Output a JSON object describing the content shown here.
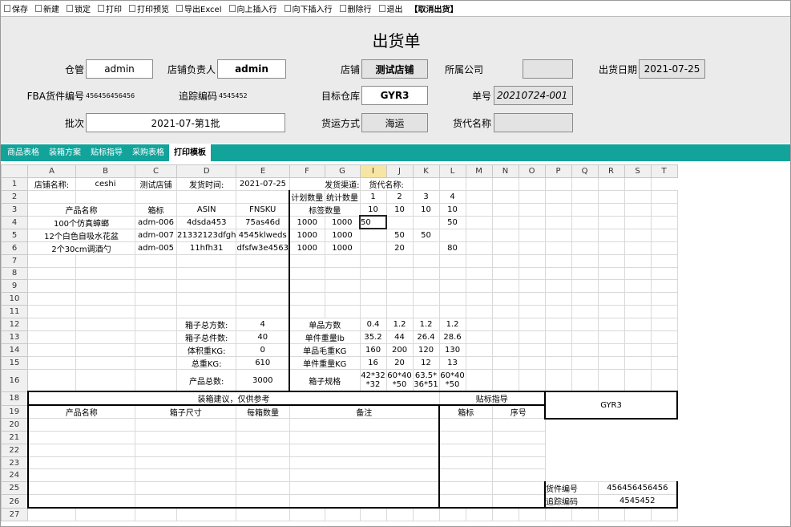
{
  "toolbar": [
    {
      "label": "保存",
      "icon": "save-icon"
    },
    {
      "label": "新建",
      "icon": "new-icon"
    },
    {
      "label": "锁定",
      "icon": "lock-icon"
    },
    {
      "label": "打印",
      "icon": "print-icon"
    },
    {
      "label": "打印预览",
      "icon": "print-preview-icon"
    },
    {
      "label": "导出Excel",
      "icon": "excel-icon"
    },
    {
      "label": "向上插入行",
      "icon": "insert-row-above-icon"
    },
    {
      "label": "向下插入行",
      "icon": "insert-row-below-icon"
    },
    {
      "label": "删除行",
      "icon": "delete-row-icon"
    },
    {
      "label": "退出",
      "icon": "exit-icon"
    },
    {
      "label": "【取消出货】",
      "icon": ""
    }
  ],
  "form": {
    "title": "出货单",
    "warehouse_label": "仓管",
    "warehouse_value": "admin",
    "store_manager_label": "店铺负责人",
    "store_manager_value": "admin",
    "store_label": "店铺",
    "store_value": "测试店铺",
    "company_label": "所属公司",
    "company_value": "",
    "ship_date_label": "出货日期",
    "ship_date_value": "2021-07-25",
    "fba_label": "FBA货件编号",
    "fba_value": "456456456456",
    "tracking_label": "追踪编码",
    "tracking_value": "4545452",
    "target_wh_label": "目标仓库",
    "target_wh_value": "GYR3",
    "order_no_label": "单号",
    "order_no_value": "20210724-001",
    "batch_label": "批次",
    "batch_value": "2021-07-第1批",
    "ship_method_label": "货运方式",
    "ship_method_value": "海运",
    "forwarder_label": "货代名称",
    "forwarder_value": ""
  },
  "tabs": [
    "商品表格",
    "装箱方案",
    "贴标指导",
    "采购表格",
    "打印模板"
  ],
  "columns": [
    "A",
    "B",
    "C",
    "D",
    "E",
    "F",
    "G",
    "I",
    "J",
    "K",
    "L",
    "M",
    "N",
    "O",
    "P",
    "Q",
    "R",
    "S",
    "T"
  ],
  "sheet": {
    "r1": {
      "a": "店铺名称:",
      "b": "ceshi",
      "c": "测试店铺",
      "d": "发货时间:",
      "e": "2021-07-25",
      "f": "发货渠道:",
      "h": "货代名称:"
    },
    "r2": {
      "f": "计划数量",
      "g": "统计数量",
      "i": "1",
      "j": "2",
      "k": "3",
      "l": "4"
    },
    "r3": {
      "ab": "产品名称",
      "c": "箱标",
      "d": "ASIN",
      "e": "FNSKU",
      "fg": "标签数量",
      "i": "10",
      "j": "10",
      "k": "10",
      "l": "10"
    },
    "r4": {
      "ab": "100个仿真蟑螂",
      "c": "adm-006",
      "d": "4dsda453",
      "e": "75as46d",
      "f": "1000",
      "g": "1000",
      "i": "50",
      "j": "",
      "k": "",
      "l": "50"
    },
    "r5": {
      "ab": "12个白色自吸水花盆",
      "c": "adm-007",
      "d": "21332123dfgh",
      "e": "4545klweds",
      "f": "1000",
      "g": "1000",
      "i": "",
      "j": "50",
      "k": "50",
      "l": ""
    },
    "r6": {
      "ab": "2个30cm调酒勺",
      "c": "adm-005",
      "d": "11hfh31",
      "e": "dfsfw3e4563",
      "f": "1000",
      "g": "1000",
      "i": "",
      "j": "20",
      "k": "",
      "l": "80"
    },
    "r12": {
      "d": "箱子总方数:",
      "e": "4",
      "fg": "单品方数",
      "i": "0.4",
      "j": "1.2",
      "k": "1.2",
      "l": "1.2"
    },
    "r13": {
      "d": "箱子总件数:",
      "e": "40",
      "fg": "单件重量lb",
      "i": "35.2",
      "j": "44",
      "k": "26.4",
      "l": "28.6"
    },
    "r14": {
      "d": "体积重KG:",
      "e": "0",
      "fg": "单品毛重KG",
      "i": "160",
      "j": "200",
      "k": "120",
      "l": "130"
    },
    "r15": {
      "d": "总重KG:",
      "e": "610",
      "fg": "单件重量KG",
      "i": "16",
      "j": "20",
      "k": "12",
      "l": "13"
    },
    "r16": {
      "d": "产品总数:",
      "e": "3000",
      "fg": "箱子规格",
      "i": "42*32 *32",
      "j": "60*40 *50",
      "k": "63.5* 36*51",
      "l": "60*40 *50"
    },
    "r18": {
      "left": "装箱建议，仅供参考",
      "right": "贴标指导"
    },
    "r19": {
      "ab": "产品名称",
      "cd": "箱子尺寸",
      "e": "每箱数量",
      "fk": "备注",
      "l": "箱标",
      "n": "序号"
    },
    "big": "GYR3",
    "r25": {
      "label": "货件编号",
      "value": "456456456456"
    },
    "r26": {
      "label": "追踪编码",
      "value": "4545452"
    }
  },
  "row_numbers": [
    "1",
    "2",
    "3",
    "4",
    "5",
    "6",
    "7",
    "8",
    "9",
    "10",
    "11",
    "12",
    "13",
    "14",
    "15",
    "16",
    "18",
    "19",
    "20",
    "21",
    "22",
    "23",
    "24",
    "25",
    "26",
    "27"
  ]
}
